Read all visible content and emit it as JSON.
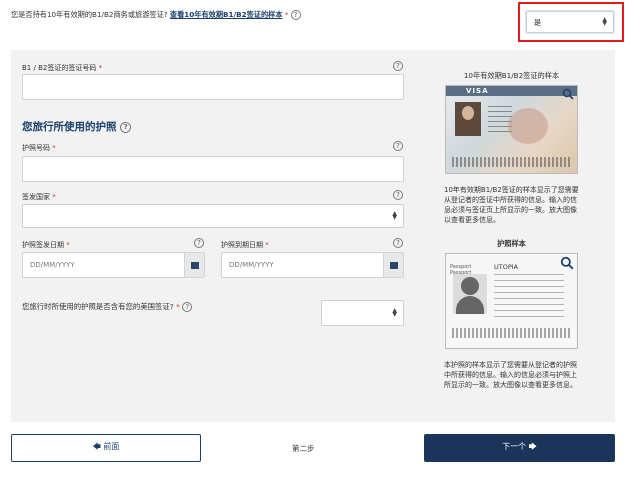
{
  "top_question": {
    "text": "您是否持有10年有效期的B1/B2商务或旅游签证?",
    "link": "查看10年有效期B1/B2签证的样本",
    "required_mark": "*",
    "select_value": "是"
  },
  "form": {
    "visa_number": {
      "label": "B1 / B2签证的签证号码",
      "required_mark": "*",
      "value": ""
    },
    "passport_section_title": "您旅行所使用的护照",
    "passport_number": {
      "label": "护照号码",
      "required_mark": "*",
      "value": ""
    },
    "issuing_country": {
      "label": "签发国家",
      "required_mark": "*",
      "value": ""
    },
    "issue_date": {
      "label": "护照签发日期",
      "required_mark": "*",
      "placeholder": "DD/MM/YYYY"
    },
    "expiry_date": {
      "label": "护照到期日期",
      "required_mark": "*",
      "placeholder": "DD/MM/YYYY"
    },
    "us_visa_question": {
      "label": "您旅行时所使用的护照是否含有您的美国签证?",
      "required_mark": "*",
      "value": ""
    }
  },
  "samples": {
    "visa_title": "10年有效期B1/B2签证的样本",
    "visa_image_header": "VISA",
    "visa_desc": "10年有效期B1/B2签证的样本显示了您需要从登记者的签证中所获得的信息。输入的信息必须与签证页上所显示的一致。放大图像以查看更多信息。",
    "passport_title": "护照样本",
    "passport_image_country": "UTOPIA",
    "passport_image_side": "Passport\nPassport",
    "passport_desc": "本护照的样本显示了您需要从登记者的护照中所获得的信息。输入的信息必须与护照上所显示的一致。放大图像以查看更多信息。"
  },
  "nav": {
    "prev_label": "前面",
    "step_label": "第二步",
    "next_label": "下一个"
  },
  "icons": {
    "help": "?",
    "prev_arrow": "🡄",
    "next_arrow": "🡆"
  },
  "colors": {
    "accent": "#1a3f6b",
    "next_button": "#1a3559",
    "highlight": "#e01e1e",
    "required": "#c0392b"
  }
}
